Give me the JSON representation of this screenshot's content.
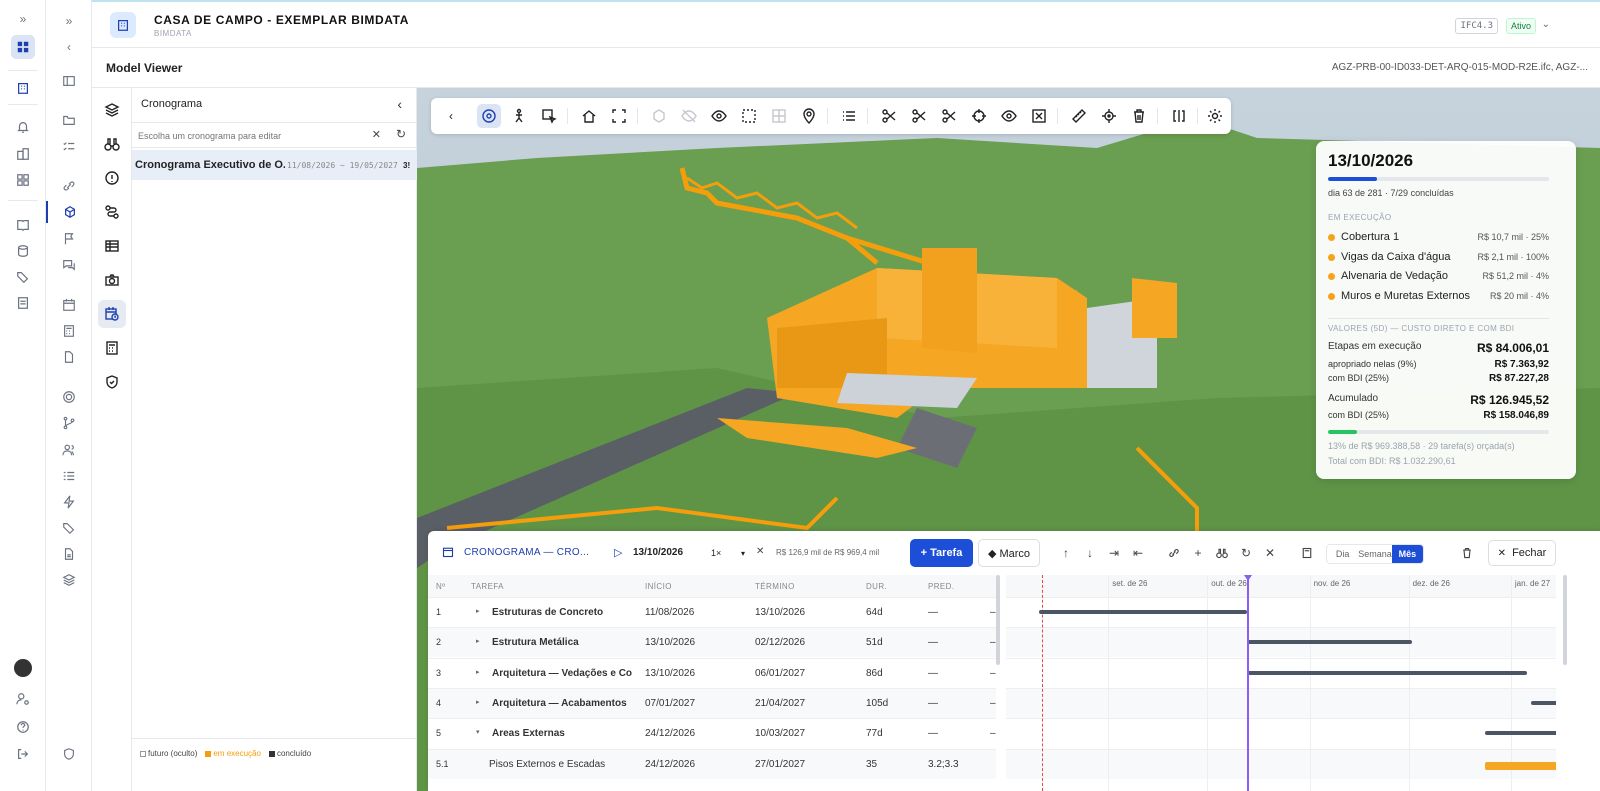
{
  "project": {
    "title": "CASA DE CAMPO - EXEMPLAR BIMDATA",
    "subtitle": "BIMDATA",
    "ifc_badge": "IFC4.3",
    "status_badge": "Ativo"
  },
  "viewer_header": {
    "title": "Model Viewer",
    "file": "AGZ-PRB-00-ID033-DET-ARQ-015-MOD-R2E.ifc, AGZ-..."
  },
  "panel": {
    "title": "Cronograma",
    "search_placeholder": "Escolha um cronograma para editar",
    "item_label": "Cronograma Executivo de O...",
    "item_dates": "11/08/2026 ~ 19/05/2027",
    "item_suffix": "3!",
    "legend": {
      "future": "futuro (oculto)",
      "running": "em execução",
      "done": "concluído"
    }
  },
  "card": {
    "date": "13/10/2026",
    "progress": 0.22,
    "day_text": "dia 63 de 281 · 7/29 concluídas",
    "running_label": "EM EXECUÇÃO",
    "tasks": [
      {
        "name": "Cobertura 1",
        "value": "R$ 10,7 mil · 25%"
      },
      {
        "name": "Vigas da Caixa d'água",
        "value": "R$ 2,1 mil · 100%"
      },
      {
        "name": "Alvenaria de Vedação",
        "value": "R$ 51,2 mil · 4%"
      },
      {
        "name": "Muros e Muretas Externos",
        "value": "R$ 20 mil · 4%"
      }
    ],
    "values_label": "VALORES (5D) — CUSTO DIRETO E COM BDI",
    "etapas_label": "Etapas em execução",
    "etapas_value": "R$ 84.006,01",
    "apropriado_label": "apropriado nelas (9%)",
    "apropriado_value": "R$ 7.363,92",
    "bdi1_label": "com BDI (25%)",
    "bdi1_value": "R$ 87.227,28",
    "acum_label": "Acumulado",
    "acum_value": "R$ 126.945,52",
    "bdi2_label": "com BDI (25%)",
    "bdi2_value": "R$ 158.046,89",
    "acum_progress": 0.13,
    "foot1": "13% de R$ 969.388,58 · 29 tarefa(s) orçada(s)",
    "foot2": "Total com BDI: R$ 1.032.290,61"
  },
  "schedule": {
    "title": "CRONOGRAMA — CRO...",
    "date": "13/10/2026",
    "speed": "1×",
    "budget": "R$ 126,9 mil de R$ 969,4 mil",
    "add_task": "+ Tarefa",
    "milestone": "◆ Marco",
    "views": [
      "Dia",
      "Semana",
      "Mês"
    ],
    "active_view": "Mês",
    "close": "Fechar",
    "columns": {
      "num": "Nº",
      "task": "TAREFA",
      "start": "INÍCIO",
      "end": "TÉRMINO",
      "dur": "DUR.",
      "pred": "PRED."
    },
    "rows": [
      {
        "n": "1",
        "caret": "▸",
        "task": "Estruturas de Concreto",
        "start": "11/08/2026",
        "end": "13/10/2026",
        "dur": "64d",
        "pred": "—",
        "x": "–"
      },
      {
        "n": "2",
        "caret": "▸",
        "task": "Estrutura Metálica",
        "start": "13/10/2026",
        "end": "02/12/2026",
        "dur": "51d",
        "pred": "—",
        "x": "–"
      },
      {
        "n": "3",
        "caret": "▸",
        "task": "Arquitetura — Vedações e Co",
        "start": "13/10/2026",
        "end": "06/01/2027",
        "dur": "86d",
        "pred": "—",
        "x": "–"
      },
      {
        "n": "4",
        "caret": "▸",
        "task": "Arquitetura — Acabamentos",
        "start": "07/01/2027",
        "end": "21/04/2027",
        "dur": "105d",
        "pred": "—",
        "x": "–"
      },
      {
        "n": "5",
        "caret": "▾",
        "task": "Áreas Externas",
        "start": "24/12/2026",
        "end": "10/03/2027",
        "dur": "77d",
        "pred": "—",
        "x": "–"
      },
      {
        "n": "5.1",
        "caret": "",
        "task": "Pisos Externos e Escadas",
        "start": "24/12/2026",
        "end": "27/01/2027",
        "dur": "35",
        "pred": "3.2;3.3",
        "x": ""
      }
    ],
    "months": [
      "set. de 26",
      "out. de 26",
      "nov. de 26",
      "dez. de 26",
      "jan. de 27"
    ]
  }
}
